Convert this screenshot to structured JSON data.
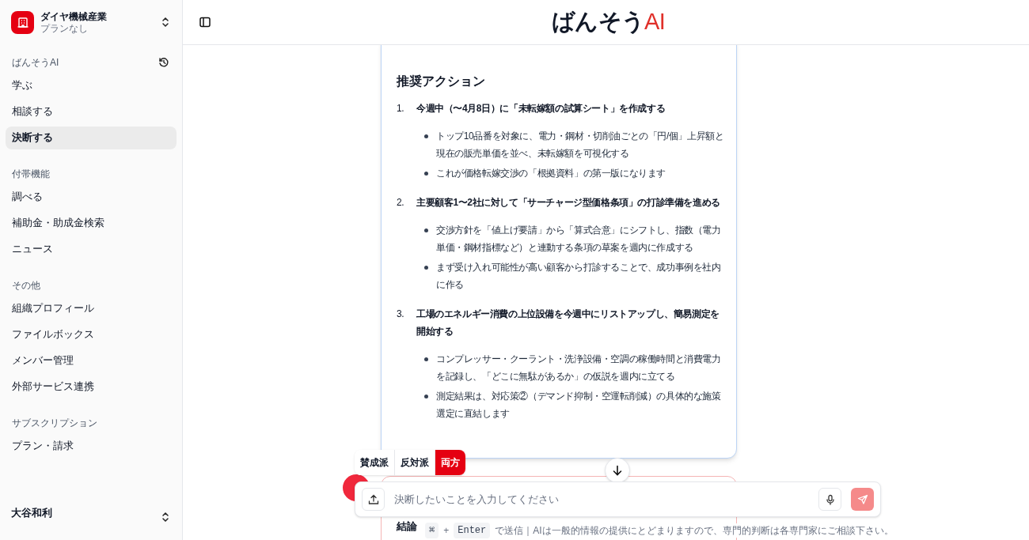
{
  "sidebar": {
    "org": {
      "name": "ダイヤ機械産業",
      "plan": "プランなし"
    },
    "sections": [
      {
        "label": "ばんそうAI",
        "history": true,
        "items": [
          {
            "label": "学ぶ",
            "selected": false
          },
          {
            "label": "相談する",
            "selected": false
          },
          {
            "label": "決断する",
            "selected": true
          }
        ]
      },
      {
        "label": "付帯機能",
        "history": false,
        "items": [
          {
            "label": "調べる",
            "selected": false
          },
          {
            "label": "補助金・助成金検索",
            "selected": false
          },
          {
            "label": "ニュース",
            "selected": false
          }
        ]
      },
      {
        "label": "その他",
        "history": false,
        "items": [
          {
            "label": "組織プロフィール",
            "selected": false
          },
          {
            "label": "ファイルボックス",
            "selected": false
          },
          {
            "label": "メンバー管理",
            "selected": false
          },
          {
            "label": "外部サービス連携",
            "selected": false
          }
        ]
      },
      {
        "label": "サブスクリプション",
        "history": false,
        "items": [
          {
            "label": "プラン・請求",
            "selected": false
          }
        ]
      }
    ],
    "user": {
      "name": "大谷和利"
    }
  },
  "header": {
    "logo": "ばんそう",
    "logo_accent": "AI"
  },
  "messages": [
    {
      "kind": "answer",
      "heading": "推奨アクション",
      "steps": [
        {
          "number": "1.",
          "title": "今週中（〜4月8日）に「未転嫁額の試算シート」を作成する",
          "bullets": [
            "トップ10品番を対象に、電力・鋼材・切削油ごとの「円/個」上昇額と現在の販売単価を並べ、未転嫁額を可視化する",
            "これが価格転嫁交渉の「根拠資料」の第一版になります"
          ]
        },
        {
          "number": "2.",
          "title": "主要顧客1〜2社に対して「サーチャージ型価格条項」の打診準備を進める",
          "bullets": [
            "交渉方針を「値上げ要請」から「算式合意」にシフトし、指数（電力単価・鋼材指標など）と連動する条項の草案を週内に作成する",
            "まず受け入れ可能性が高い顧客から打診することで、成功事例を社内に作る"
          ]
        },
        {
          "number": "3.",
          "title": "工場のエネルギー消費の上位設備を今週中にリストアップし、簡易測定を開始する",
          "bullets": [
            "コンプレッサー・クーラント・洗浄設備・空調の稼働時間と消費電力を記録し、「どこに無駄があるか」の仮説を週内に立てる",
            "測定結果は、対応策②（デマンド抑制・空運転削減）の具体的な施策選定に直結します"
          ]
        }
      ]
    },
    {
      "kind": "critique",
      "heading": "結論"
    }
  ],
  "stance_tabs": [
    {
      "label": "賛成派",
      "selected": false
    },
    {
      "label": "反対派",
      "selected": false
    },
    {
      "label": "両方",
      "selected": true
    }
  ],
  "composer": {
    "placeholder": "決断したいことを入力してください"
  },
  "hint": {
    "keys": [
      {
        "kind": "key",
        "text": "⌘"
      },
      {
        "kind": "plain",
        "text": "+"
      },
      {
        "kind": "key",
        "text": "Enter"
      }
    ],
    "text": "で送信｜AIは一般的情報の提供にとどまりますので、専門的判断は各専門家にご相談下さい。"
  }
}
